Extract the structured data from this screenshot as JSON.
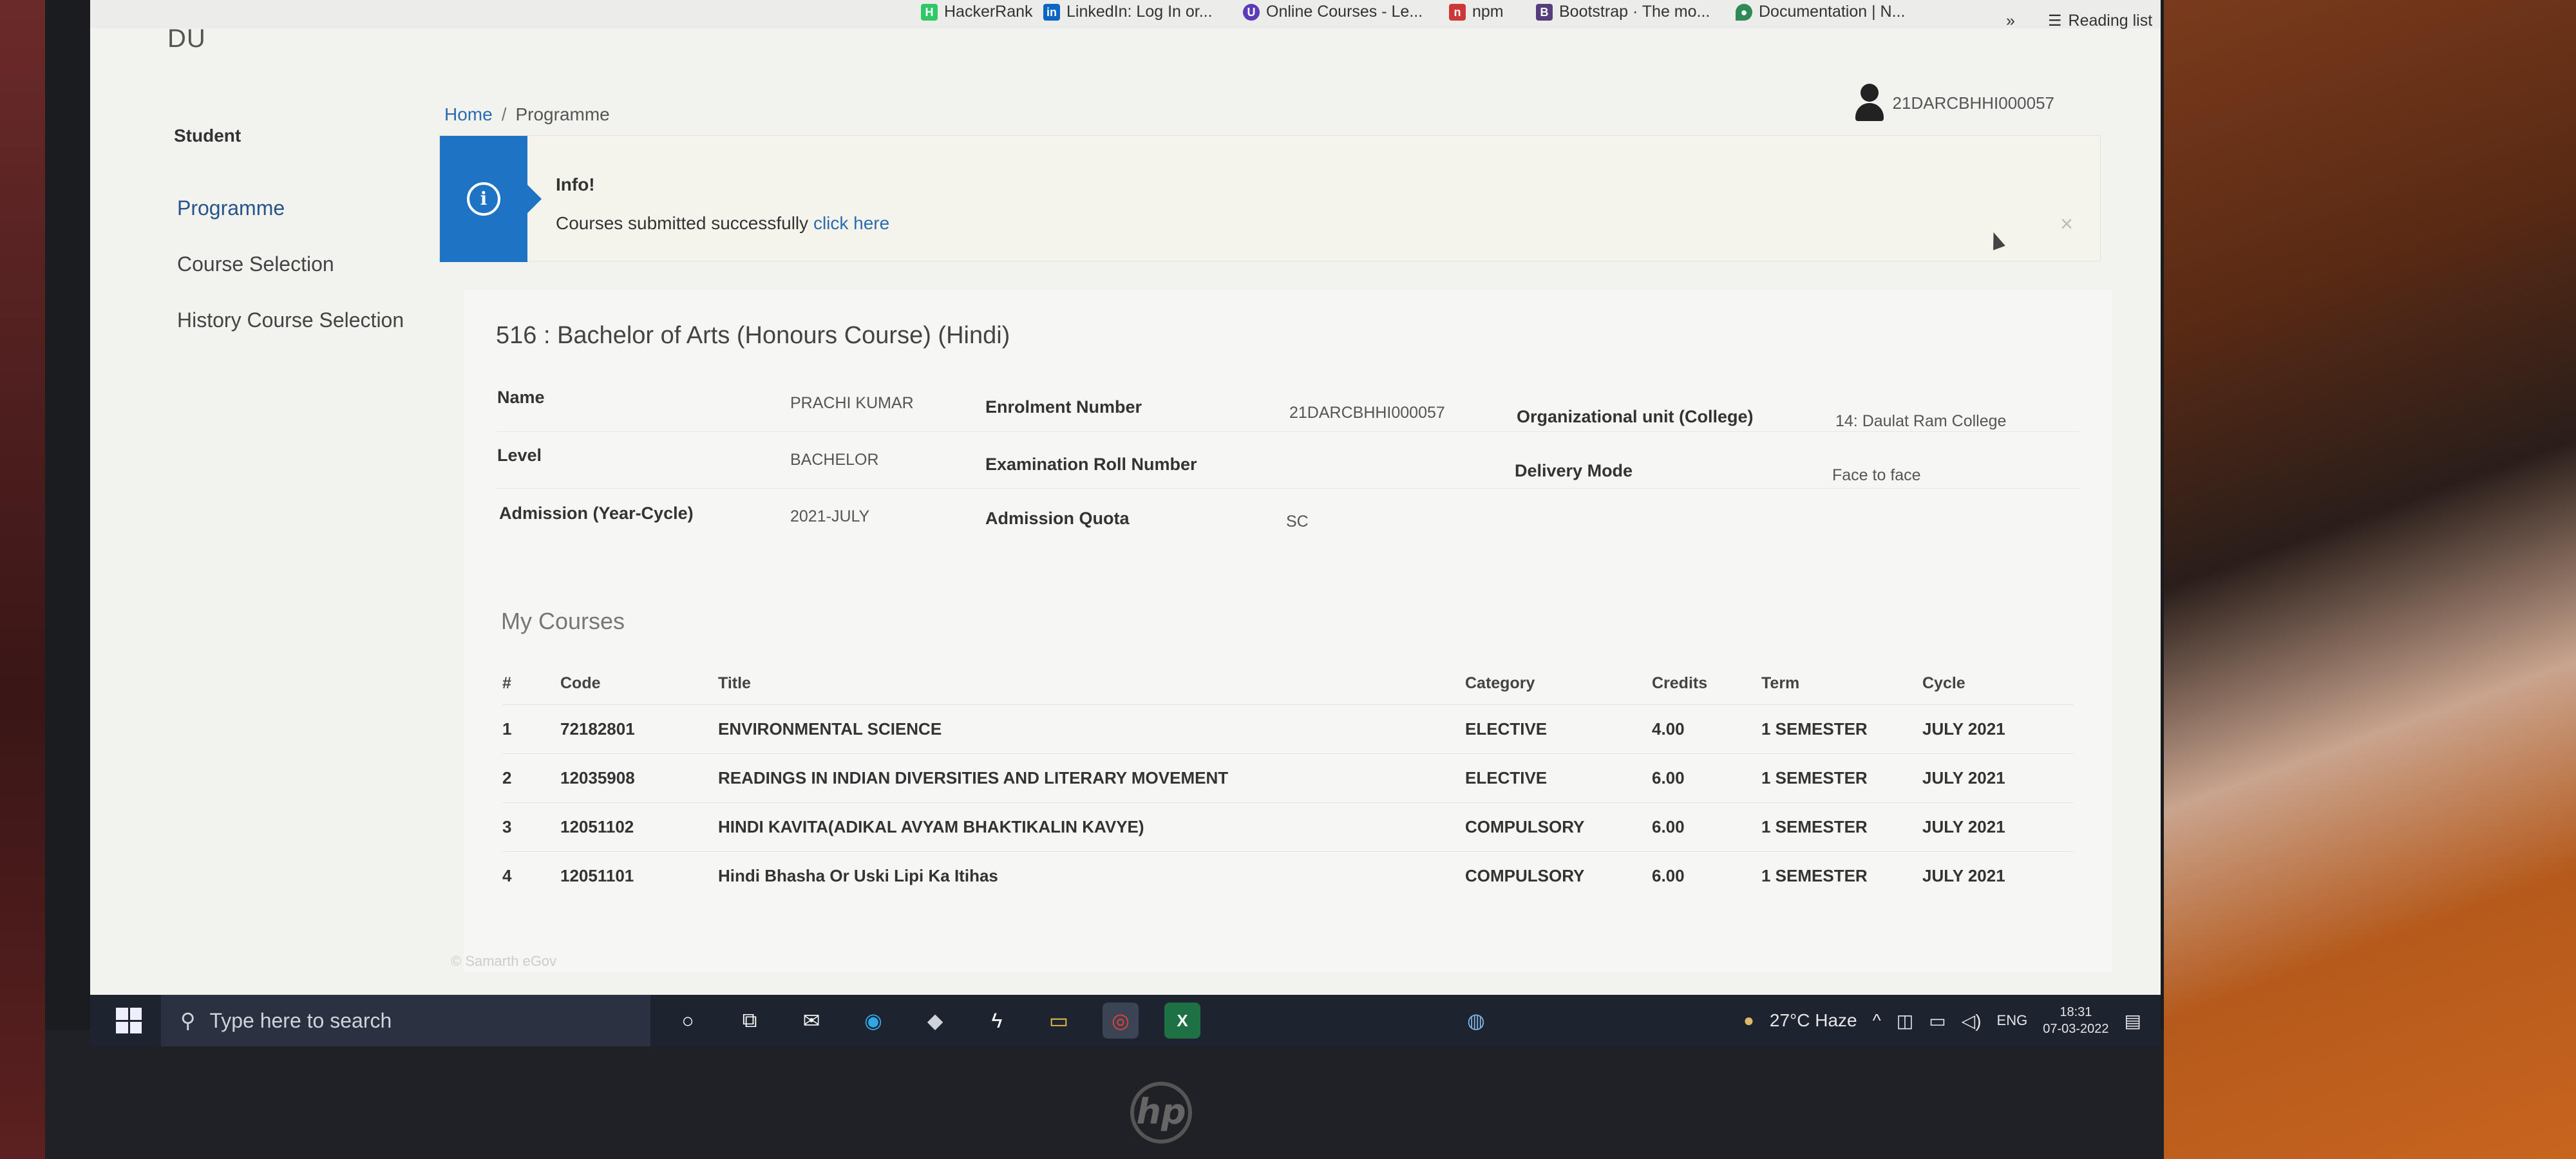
{
  "browser": {
    "bookmarks": [
      {
        "icon": "hackerrank-icon",
        "label": "HackerRank",
        "color": "#2ec866"
      },
      {
        "icon": "linkedin-icon",
        "label": "LinkedIn: Log In or...",
        "color": "#0a66c2"
      },
      {
        "icon": "coursera-icon",
        "label": "Online Courses - Le...",
        "color": "#5b3db8"
      },
      {
        "icon": "npm-icon",
        "label": "npm",
        "color": "#cb3837"
      },
      {
        "icon": "bootstrap-icon",
        "label": "Bootstrap · The mo...",
        "color": "#563d7c"
      },
      {
        "icon": "mongodb-icon",
        "label": "Documentation | N...",
        "color": "#2e8b57"
      }
    ],
    "more": "»",
    "reading_list": "Reading list"
  },
  "app": {
    "brand": "DU"
  },
  "user": {
    "id": "21DARCBHHI000057"
  },
  "sidebar": {
    "title": "Student",
    "items": [
      {
        "label": "Programme",
        "active": true
      },
      {
        "label": "Course Selection",
        "active": false
      },
      {
        "label": "History Course Selection",
        "active": false
      }
    ]
  },
  "breadcrumb": {
    "home": "Home",
    "sep": "/",
    "current": "Programme"
  },
  "info": {
    "title": "Info!",
    "message": "Courses submitted successfully",
    "link": "click here",
    "close": "×"
  },
  "programme": {
    "title": "516 : Bachelor of Arts (Honours Course) (Hindi)",
    "name_label": "Name",
    "name": "PRACHI KUMAR",
    "level_label": "Level",
    "level": "BACHELOR",
    "admission_label": "Admission (Year-Cycle)",
    "admission": "2021-JULY",
    "enrolment_label": "Enrolment Number",
    "enrolment": "21DARCBHHI000057",
    "roll_label": "Examination Roll Number",
    "roll": "",
    "quota_label": "Admission Quota",
    "quota": "SC",
    "org_label": "Organizational unit (College)",
    "org": "14: Daulat Ram College",
    "delivery_label": "Delivery Mode",
    "delivery": "Face to face"
  },
  "courses": {
    "heading": "My Courses",
    "columns": [
      "#",
      "Code",
      "Title",
      "Category",
      "Credits",
      "Term",
      "Cycle"
    ],
    "rows": [
      [
        "1",
        "72182801",
        "ENVIRONMENTAL SCIENCE",
        "ELECTIVE",
        "4.00",
        "1 SEMESTER",
        "JULY 2021"
      ],
      [
        "2",
        "12035908",
        "READINGS IN INDIAN DIVERSITIES AND LITERARY MOVEMENT",
        "ELECTIVE",
        "6.00",
        "1 SEMESTER",
        "JULY 2021"
      ],
      [
        "3",
        "12051102",
        "HINDI KAVITA(ADIKAL AVYAM BHAKTIKALIN KAVYE)",
        "COMPULSORY",
        "6.00",
        "1 SEMESTER",
        "JULY 2021"
      ],
      [
        "4",
        "12051101",
        "Hindi Bhasha Or Uski Lipi Ka Itihas",
        "COMPULSORY",
        "6.00",
        "1 SEMESTER",
        "JULY 2021"
      ]
    ]
  },
  "footer": {
    "text": "© Samarth eGov"
  },
  "taskbar": {
    "search_placeholder": "Type here to search",
    "weather": "27°C  Haze",
    "lang": "ENG",
    "time": "18:31",
    "date": "07-03-2022"
  },
  "device": {
    "logo": "hp"
  }
}
